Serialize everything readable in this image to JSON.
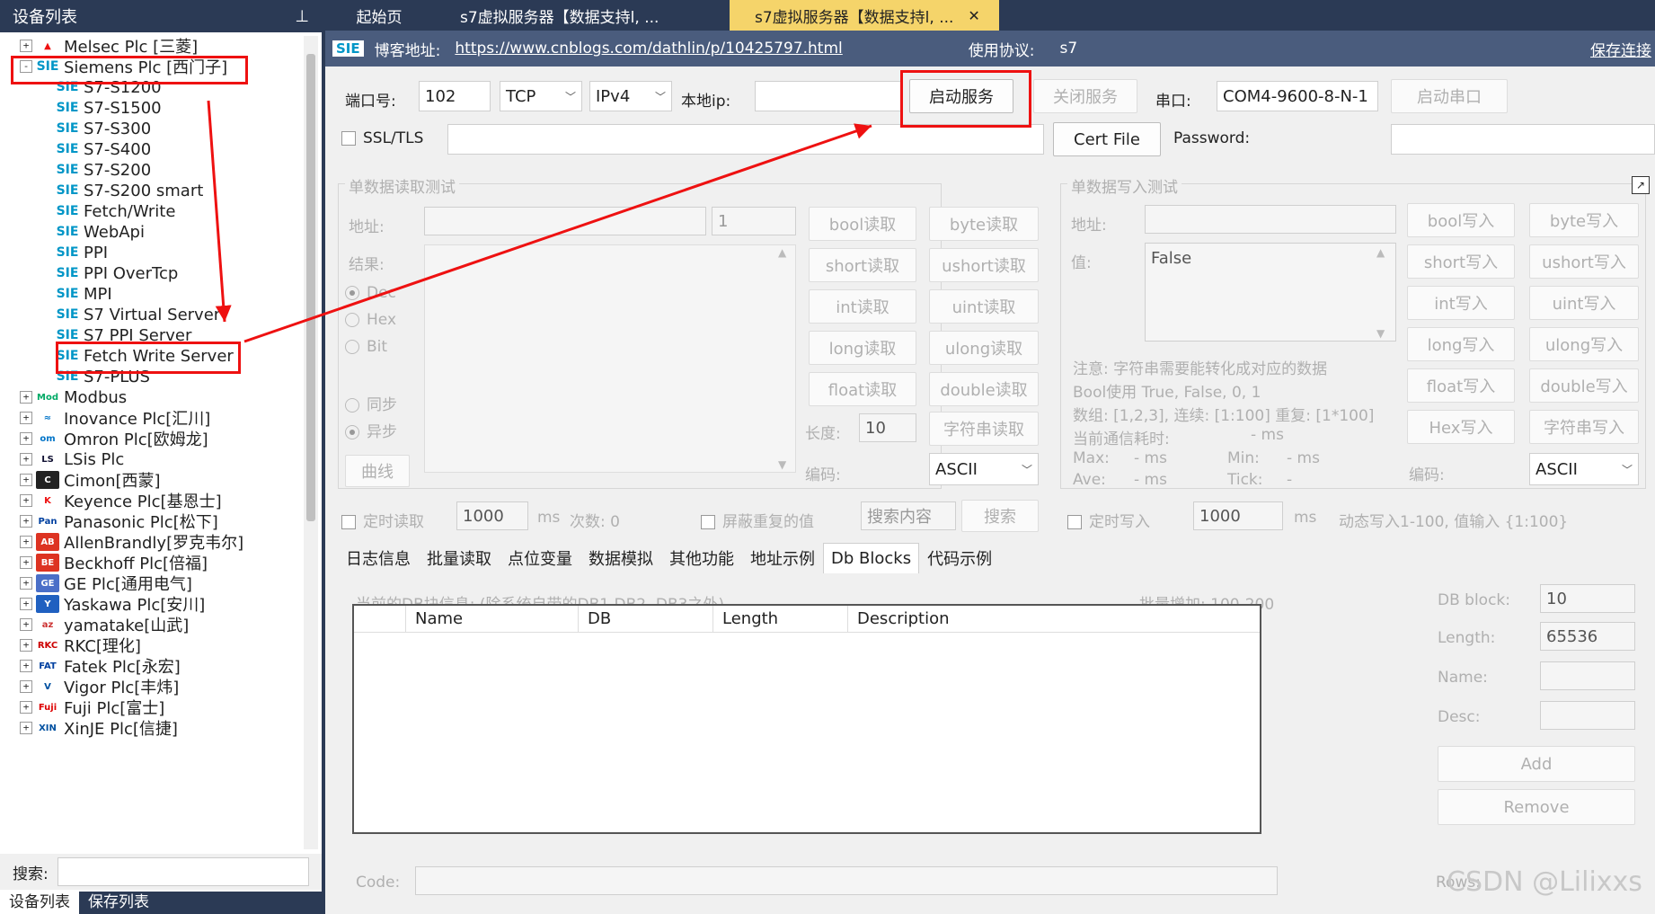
{
  "left_panel": {
    "title": "设备列表",
    "pin_icon": "pin-icon",
    "search_label": "搜索:",
    "search_value": "",
    "bottom_tabs": [
      "设备列表",
      "保存列表"
    ]
  },
  "tree": [
    {
      "label": "Melsec Plc [三菱]",
      "level": 0,
      "expander": "+",
      "icon": "mitsubishi-icon"
    },
    {
      "label": "Siemens Plc [西门子]",
      "level": 0,
      "expander": "-",
      "icon": "siemens-icon"
    },
    {
      "label": "S7-S1200",
      "level": 1,
      "icon": "siemens-icon"
    },
    {
      "label": "S7-S1500",
      "level": 1,
      "icon": "siemens-icon"
    },
    {
      "label": "S7-S300",
      "level": 1,
      "icon": "siemens-icon"
    },
    {
      "label": "S7-S400",
      "level": 1,
      "icon": "siemens-icon"
    },
    {
      "label": "S7-S200",
      "level": 1,
      "icon": "siemens-icon"
    },
    {
      "label": "S7-S200 smart",
      "level": 1,
      "icon": "siemens-icon"
    },
    {
      "label": "Fetch/Write",
      "level": 1,
      "icon": "siemens-icon"
    },
    {
      "label": "WebApi",
      "level": 1,
      "icon": "siemens-icon"
    },
    {
      "label": "PPI",
      "level": 1,
      "icon": "siemens-icon"
    },
    {
      "label": "PPI OverTcp",
      "level": 1,
      "icon": "siemens-icon"
    },
    {
      "label": "MPI",
      "level": 1,
      "icon": "siemens-icon"
    },
    {
      "label": "S7 Virtual Server",
      "level": 1,
      "icon": "siemens-icon"
    },
    {
      "label": "S7 PPI Server",
      "level": 1,
      "icon": "siemens-icon"
    },
    {
      "label": "Fetch Write Server",
      "level": 1,
      "icon": "siemens-icon"
    },
    {
      "label": "S7-PLUS",
      "level": 1,
      "icon": "siemens-icon"
    },
    {
      "label": "Modbus",
      "level": 0,
      "expander": "+",
      "icon": "modbus-icon"
    },
    {
      "label": "Inovance Plc[汇川]",
      "level": 0,
      "expander": "+",
      "icon": "inovance-icon"
    },
    {
      "label": "Omron Plc[欧姆龙]",
      "level": 0,
      "expander": "+",
      "icon": "omron-icon"
    },
    {
      "label": "LSis Plc",
      "level": 0,
      "expander": "+",
      "icon": "lsis-icon"
    },
    {
      "label": "Cimon[西蒙]",
      "level": 0,
      "expander": "+",
      "icon": "cimon-icon"
    },
    {
      "label": "Keyence Plc[基恩士]",
      "level": 0,
      "expander": "+",
      "icon": "keyence-icon"
    },
    {
      "label": "Panasonic Plc[松下]",
      "level": 0,
      "expander": "+",
      "icon": "panasonic-icon"
    },
    {
      "label": "AllenBrandly[罗克韦尔]",
      "level": 0,
      "expander": "+",
      "icon": "allenbradley-icon"
    },
    {
      "label": "Beckhoff Plc[倍福]",
      "level": 0,
      "expander": "+",
      "icon": "beckhoff-icon"
    },
    {
      "label": "GE Plc[通用电气]",
      "level": 0,
      "expander": "+",
      "icon": "ge-icon"
    },
    {
      "label": "Yaskawa Plc[安川]",
      "level": 0,
      "expander": "+",
      "icon": "yaskawa-icon"
    },
    {
      "label": "yamatake[山武]",
      "level": 0,
      "expander": "+",
      "icon": "yamatake-icon"
    },
    {
      "label": "RKC[理化]",
      "level": 0,
      "expander": "+",
      "icon": "rkc-icon"
    },
    {
      "label": "Fatek Plc[永宏]",
      "level": 0,
      "expander": "+",
      "icon": "fatek-icon"
    },
    {
      "label": "Vigor Plc[丰炜]",
      "level": 0,
      "expander": "+",
      "icon": "vigor-icon"
    },
    {
      "label": "Fuji Plc[富士]",
      "level": 0,
      "expander": "+",
      "icon": "fuji-icon"
    },
    {
      "label": "XinJE Plc[信捷]",
      "level": 0,
      "expander": "+",
      "icon": "xinje-icon"
    }
  ],
  "tabs": [
    {
      "label": "起始页",
      "active": false
    },
    {
      "label": "s7虚拟服务器【数据支持l, ...",
      "active": false
    },
    {
      "label": "s7虚拟服务器【数据支持l, ...",
      "active": true,
      "close": "✕"
    }
  ],
  "urlbar": {
    "badge": "SIE",
    "blog_label": "博客地址:",
    "url": "https://www.cnblogs.com/dathlin/p/10425797.html",
    "protocol_label": "使用协议:",
    "protocol": "s7",
    "save_link": "保存连接"
  },
  "conn": {
    "port_label": "端口号:",
    "port": "102",
    "transport": "TCP",
    "ipver": "IPv4",
    "localip_label": "本地ip:",
    "localip": "",
    "start_btn": "启动服务",
    "stop_btn": "关闭服务",
    "serial_label": "串口:",
    "serial": "COM4-9600-8-N-1",
    "start_serial_btn": "启动串口",
    "ssl_label": "SSL/TLS",
    "ssl_path": "",
    "cert_btn": "Cert File",
    "password_label": "Password:",
    "password": ""
  },
  "read_group": {
    "title": "单数据读取测试",
    "addr_label": "地址:",
    "addr": "",
    "count": "1",
    "result_label": "结果:",
    "radios": [
      "Dec",
      "Hex",
      "Bit"
    ],
    "sync_radios": [
      "同步",
      "异步"
    ],
    "curve_btn": "曲线",
    "buttons": [
      [
        "bool读取",
        "byte读取"
      ],
      [
        "short读取",
        "ushort读取"
      ],
      [
        "int读取",
        "uint读取"
      ],
      [
        "long读取",
        "ulong读取"
      ],
      [
        "float读取",
        "double读取"
      ]
    ],
    "length_label": "长度:",
    "length": "10",
    "string_btn": "字符串读取",
    "encode_label": "编码:",
    "encode": "ASCII",
    "timer_label": "定时读取",
    "timer_value": "1000",
    "ms": "ms",
    "count_text": "次数: 0",
    "mask_label": "屏蔽重复的值",
    "search_content": "搜索内容",
    "search_btn": "搜索"
  },
  "write_group": {
    "title": "单数据写入测试",
    "addr_label": "地址:",
    "addr": "",
    "value_label": "值:",
    "value": "False",
    "note1": "注意: 字符串需要能转化成对应的数据",
    "note2": "Bool使用 True, False, 0, 1",
    "note3": "数组: [1,2,3], 连续: [1:100] 重复: [1*100]",
    "elapsed_label": "当前通信耗时:",
    "elapsed_value": "- ms",
    "max_label": "Max:",
    "max_value": "- ms",
    "min_label": "Min:",
    "min_value": "- ms",
    "ave_label": "Ave:",
    "ave_value": "- ms",
    "tick_label": "Tick:",
    "tick_value": "-",
    "buttons": [
      [
        "bool写入",
        "byte写入"
      ],
      [
        "short写入",
        "ushort写入"
      ],
      [
        "int写入",
        "uint写入"
      ],
      [
        "long写入",
        "ulong写入"
      ],
      [
        "float写入",
        "double写入"
      ],
      [
        "Hex写入",
        "字符串写入"
      ]
    ],
    "encode_label": "编码:",
    "encode": "ASCII",
    "timer_label": "定时写入",
    "timer_value": "1000",
    "ms": "ms",
    "dynamic_hint": "动态写入1-100, 值输入 {1:100}"
  },
  "bottom_tabs": [
    {
      "label": "日志信息",
      "active": false
    },
    {
      "label": "批量读取",
      "active": false
    },
    {
      "label": "点位变量",
      "active": false
    },
    {
      "label": "数据模拟",
      "active": false
    },
    {
      "label": "其他功能",
      "active": false
    },
    {
      "label": "地址示例",
      "active": false
    },
    {
      "label": "Db Blocks",
      "active": true
    },
    {
      "label": "代码示例",
      "active": false
    }
  ],
  "db": {
    "info": "当前的DB块信息: (除系统自带的DB1,DB2, DB3之外)",
    "batch": "批量增加: 100-200",
    "columns": [
      "",
      "Name",
      "DB",
      "Length",
      "Description"
    ],
    "dbblock_label": "DB block:",
    "dbblock": "10",
    "length_label": "Length:",
    "length": "65536",
    "name_label": "Name:",
    "name": "",
    "desc_label": "Desc:",
    "desc": "",
    "add_btn": "Add",
    "remove_btn": "Remove",
    "code_label": "Code:",
    "code": "",
    "rows_label": "Rows:"
  },
  "watermark": "CSDN @Lilixxs",
  "colors": {
    "accent_tab": "#f5d46a",
    "titlebar": "#2b3a55",
    "highlight": "#ee1111",
    "siemens": "#0096c7"
  }
}
